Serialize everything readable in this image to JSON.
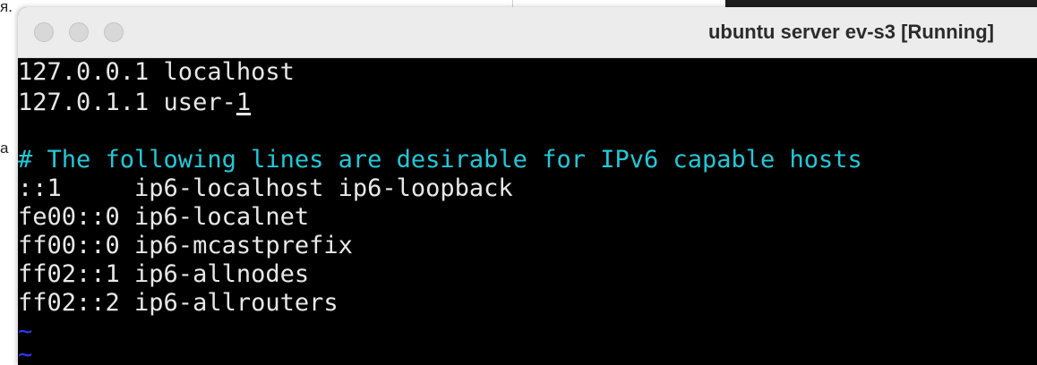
{
  "backdrop": {
    "fragment_top": "я.",
    "fragment_mid": "a"
  },
  "window": {
    "title": "ubuntu server ev-s3 [Running]",
    "controls": {
      "close": "close-button",
      "minimize": "minimize-button",
      "zoom": "zoom-button"
    }
  },
  "terminal": {
    "lines": [
      {
        "text": "127.0.0.1 localhost",
        "kind": "normal"
      },
      {
        "text": "127.0.1.1 user-",
        "cursor_char": "1",
        "kind": "normal"
      },
      {
        "text": "",
        "kind": "blank"
      },
      {
        "text": "# The following lines are desirable for IPv6 capable hosts",
        "kind": "comment"
      },
      {
        "text": "::1     ip6-localhost ip6-loopback",
        "kind": "normal"
      },
      {
        "text": "fe00::0 ip6-localnet",
        "kind": "normal"
      },
      {
        "text": "ff00::0 ip6-mcastprefix",
        "kind": "normal"
      },
      {
        "text": "ff02::1 ip6-allnodes",
        "kind": "normal"
      },
      {
        "text": "ff02::2 ip6-allrouters",
        "kind": "normal"
      },
      {
        "text": "~",
        "kind": "tilde"
      },
      {
        "text": "~",
        "kind": "tilde"
      }
    ],
    "colors": {
      "background": "#000000",
      "text": "#e8e8e8",
      "comment": "#22c8d8",
      "tilde": "#2a3cff"
    }
  }
}
